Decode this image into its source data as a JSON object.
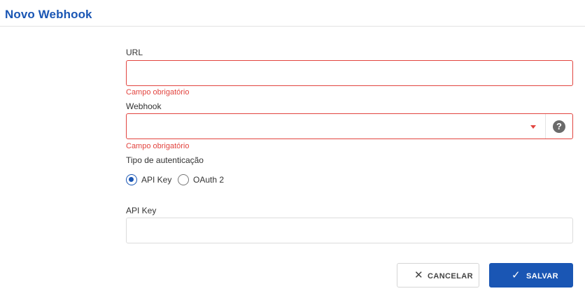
{
  "header": {
    "title": "Novo Webhook"
  },
  "form": {
    "url": {
      "label": "URL",
      "value": "",
      "error": "Campo obrigatório"
    },
    "webhook": {
      "label": "Webhook",
      "selected": "",
      "error": "Campo obrigatório",
      "help_glyph": "?"
    },
    "auth": {
      "label": "Tipo de autenticação",
      "options": [
        {
          "label": "API Key",
          "checked": true
        },
        {
          "label": "OAuth 2",
          "checked": false
        }
      ]
    },
    "api_key": {
      "label": "API Key",
      "value": ""
    }
  },
  "actions": {
    "cancel_icon": "✕",
    "cancel_label": "CANCELAR",
    "save_icon": "✓",
    "save_label": "SALVAR"
  },
  "colors": {
    "primary": "#1a56b4",
    "error": "#e2443f",
    "border": "#dcdcdc"
  }
}
